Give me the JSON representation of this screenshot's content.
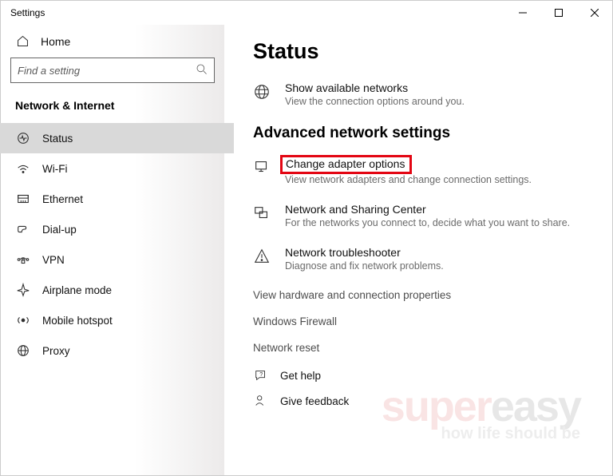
{
  "window": {
    "title": "Settings"
  },
  "sidebar": {
    "home_label": "Home",
    "search_placeholder": "Find a setting",
    "category": "Network & Internet",
    "items": [
      {
        "label": "Status"
      },
      {
        "label": "Wi-Fi"
      },
      {
        "label": "Ethernet"
      },
      {
        "label": "Dial-up"
      },
      {
        "label": "VPN"
      },
      {
        "label": "Airplane mode"
      },
      {
        "label": "Mobile hotspot"
      },
      {
        "label": "Proxy"
      }
    ]
  },
  "main": {
    "title": "Status",
    "show_networks": {
      "title": "Show available networks",
      "desc": "View the connection options around you."
    },
    "advanced_heading": "Advanced network settings",
    "adapter": {
      "title": "Change adapter options",
      "desc": "View network adapters and change connection settings."
    },
    "sharing": {
      "title": "Network and Sharing Center",
      "desc": "For the networks you connect to, decide what you want to share."
    },
    "troubleshoot": {
      "title": "Network troubleshooter",
      "desc": "Diagnose and fix network problems."
    },
    "link_hw": "View hardware and connection properties",
    "link_fw": "Windows Firewall",
    "link_reset": "Network reset",
    "help": "Get help",
    "feedback": "Give feedback"
  },
  "watermark": {
    "line1a": "super",
    "line1b": "easy",
    "tag": "how life should be"
  }
}
